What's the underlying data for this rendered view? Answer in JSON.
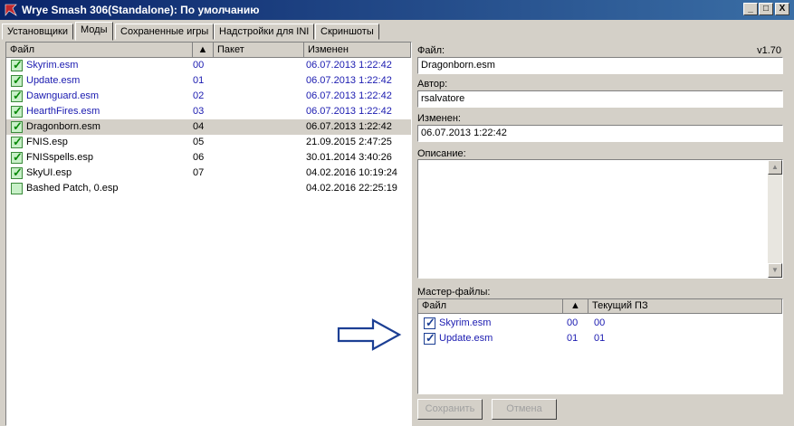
{
  "window": {
    "title": "Wrye Smash 306(Standalone): По умолчанию",
    "min_label": "_",
    "max_label": "□",
    "close_label": "X"
  },
  "tabs": [
    {
      "label": "Установщики",
      "active": false
    },
    {
      "label": "Моды",
      "active": true
    },
    {
      "label": "Сохраненные игры",
      "active": false
    },
    {
      "label": "Надстройки для INI",
      "active": false
    },
    {
      "label": "Скриншоты",
      "active": false
    }
  ],
  "mods_list": {
    "columns": {
      "file": "Файл",
      "sort_indicator": "▲",
      "package": "Пакет",
      "modified": "Изменен"
    },
    "rows": [
      {
        "file": "Skyrim.esm",
        "order": "00",
        "modified": "06.07.2013 1:22:42",
        "checked": true,
        "blue": true,
        "selected": false
      },
      {
        "file": "Update.esm",
        "order": "01",
        "modified": "06.07.2013 1:22:42",
        "checked": true,
        "blue": true,
        "selected": false
      },
      {
        "file": "Dawnguard.esm",
        "order": "02",
        "modified": "06.07.2013 1:22:42",
        "checked": true,
        "blue": true,
        "selected": false
      },
      {
        "file": "HearthFires.esm",
        "order": "03",
        "modified": "06.07.2013 1:22:42",
        "checked": true,
        "blue": true,
        "selected": false
      },
      {
        "file": "Dragonborn.esm",
        "order": "04",
        "modified": "06.07.2013 1:22:42",
        "checked": true,
        "blue": false,
        "selected": true
      },
      {
        "file": "FNIS.esp",
        "order": "05",
        "modified": "21.09.2015 2:47:25",
        "checked": true,
        "blue": false,
        "selected": false
      },
      {
        "file": "FNISspells.esp",
        "order": "06",
        "modified": "30.01.2014 3:40:26",
        "checked": true,
        "blue": false,
        "selected": false
      },
      {
        "file": "SkyUI.esp",
        "order": "07",
        "modified": "04.02.2016 10:19:24",
        "checked": true,
        "blue": false,
        "selected": false
      },
      {
        "file": "Bashed Patch, 0.esp",
        "order": "",
        "modified": "04.02.2016 22:25:19",
        "checked": false,
        "blue": false,
        "selected": false
      }
    ]
  },
  "details": {
    "file_label": "Файл:",
    "version": "v1.70",
    "file_value": "Dragonborn.esm",
    "author_label": "Автор:",
    "author_value": "rsalvatore",
    "modified_label": "Изменен:",
    "modified_value": "06.07.2013 1:22:42",
    "description_label": "Описание:",
    "description_value": "",
    "masters_label": "Мастер-файлы:",
    "masters_columns": {
      "file": "Файл",
      "sort_indicator": "▲",
      "current": "Текущий ПЗ"
    },
    "masters": [
      {
        "file": "Skyrim.esm",
        "order": "00",
        "current": "00"
      },
      {
        "file": "Update.esm",
        "order": "01",
        "current": "01"
      }
    ],
    "save_label": "Сохранить",
    "cancel_label": "Отмена"
  },
  "colors": {
    "accent_blue": "#1a1ab0",
    "arrow": "#1c3f94",
    "titlebar": "#0a246a"
  }
}
